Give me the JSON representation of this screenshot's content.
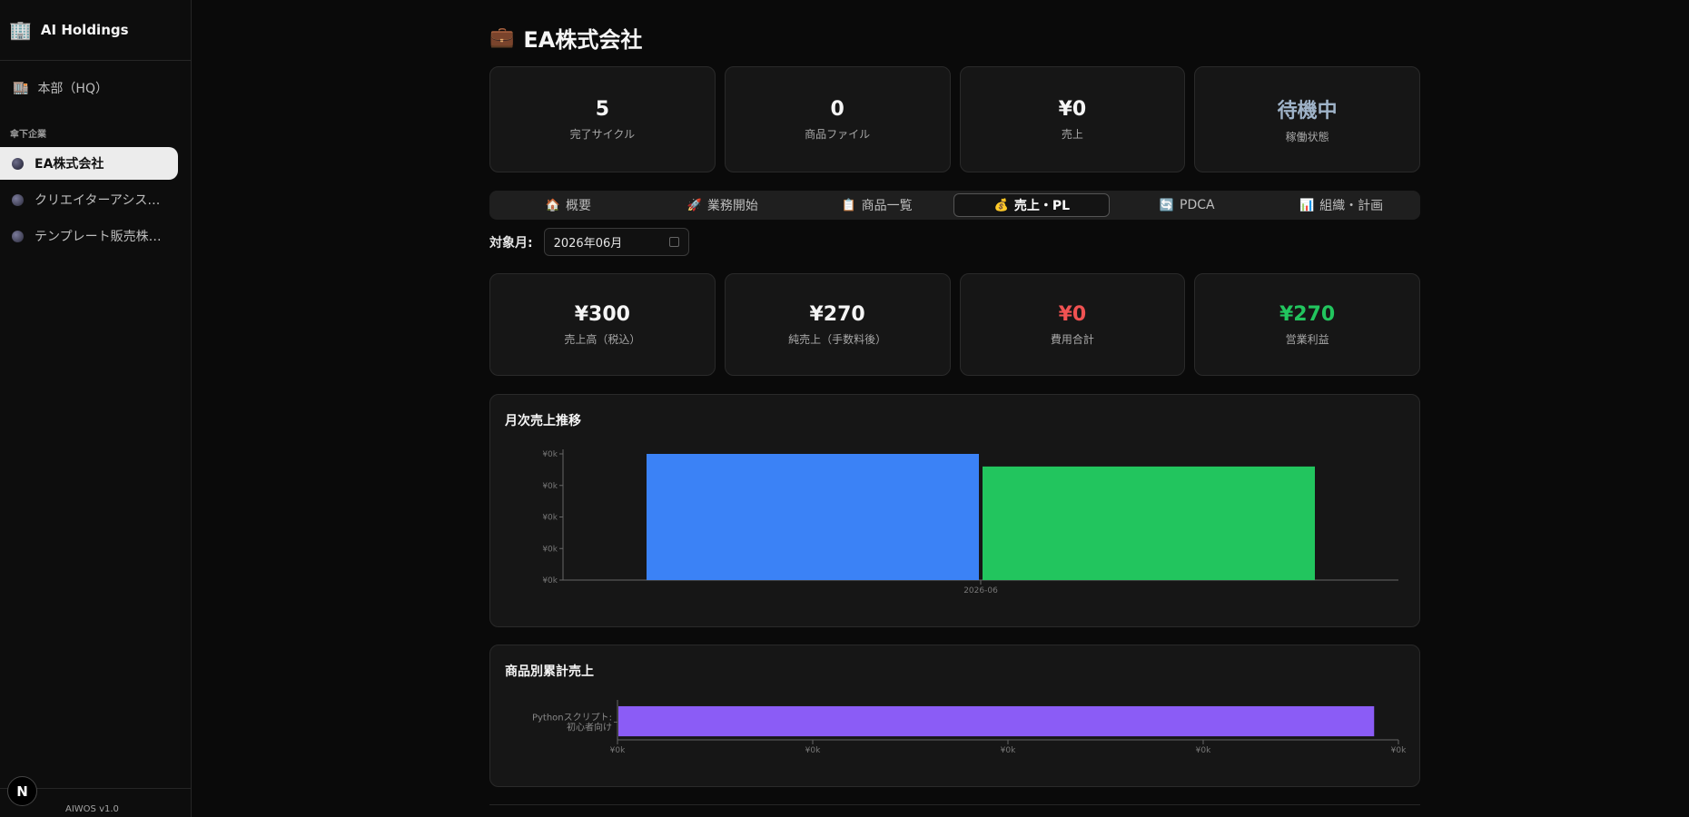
{
  "sidebar": {
    "brand_icon": "building-icon",
    "brand": "AI Holdings",
    "hq_icon": "office-building-icon",
    "hq": "本部（HQ）",
    "section_label": "傘下企業",
    "items": [
      {
        "label": "EA株式会社",
        "active": true
      },
      {
        "label": "クリエイターアシス…",
        "active": false
      },
      {
        "label": "テンプレート販売株…",
        "active": false
      }
    ],
    "version": "AIWOS v1.0",
    "badge": "N"
  },
  "page": {
    "title_icon": "briefcase-icon",
    "title": "EA株式会社"
  },
  "stats": [
    {
      "value": "5",
      "label": "完了サイクル"
    },
    {
      "value": "0",
      "label": "商品ファイル"
    },
    {
      "value": "¥0",
      "label": "売上"
    },
    {
      "value": "待機中",
      "label": "稼働状態"
    }
  ],
  "tabs": [
    {
      "icon": "house-icon",
      "glyph": "🏠",
      "label": "概要"
    },
    {
      "icon": "rocket-icon",
      "glyph": "🚀",
      "label": "業務開始"
    },
    {
      "icon": "clipboard-icon",
      "glyph": "📋",
      "label": "商品一覧"
    },
    {
      "icon": "money-bag-icon",
      "glyph": "💰",
      "label": "売上・PL"
    },
    {
      "icon": "cycle-icon",
      "glyph": "🔄",
      "label": "PDCA"
    },
    {
      "icon": "org-chart-icon",
      "glyph": "📊",
      "label": "組織・計画"
    }
  ],
  "active_tab": 3,
  "month_filter": {
    "label": "対象月:",
    "value": "2026年06月"
  },
  "pl": [
    {
      "value": "¥300",
      "label": "売上高（税込）",
      "color": "#f5f5f5"
    },
    {
      "value": "¥270",
      "label": "純売上（手数料後）",
      "color": "#f5f5f5"
    },
    {
      "value": "¥0",
      "label": "費用合計",
      "color": "#f05252"
    },
    {
      "value": "¥270",
      "label": "営業利益",
      "color": "#22c55e"
    }
  ],
  "colors": {
    "blue": "#3b82f6",
    "green": "#22c55e",
    "purple": "#8b5cf6"
  },
  "chart_data": [
    {
      "type": "bar",
      "title": "月次売上推移",
      "categories": [
        "2026-06"
      ],
      "series": [
        {
          "values": [
            300
          ],
          "color": "#3b82f6"
        },
        {
          "values": [
            270
          ],
          "color": "#22c55e"
        }
      ],
      "ylim": [
        0,
        300
      ],
      "y_tick_labels": [
        "¥0k",
        "¥0k",
        "¥0k",
        "¥0k",
        "¥0k"
      ]
    },
    {
      "type": "bar",
      "orientation": "horizontal",
      "title": "商品別累計売上",
      "categories": [
        "Pythonスクリプト: 初心者向け"
      ],
      "category_lines": [
        "Pythonスクリプト:",
        "初心者向け"
      ],
      "values": [
        300
      ],
      "color": "#8b5cf6",
      "xlim": [
        0,
        310
      ],
      "x_tick_labels": [
        "¥0k",
        "¥0k",
        "¥0k",
        "¥0k",
        "¥0k"
      ]
    }
  ]
}
